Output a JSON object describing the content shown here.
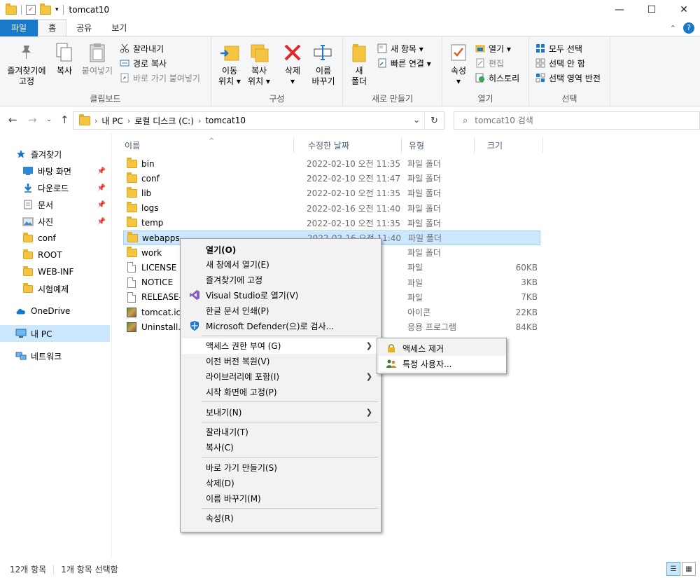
{
  "window": {
    "title": "tomcat10",
    "controls": {
      "minimize": "—",
      "maximize": "☐",
      "close": "✕"
    }
  },
  "ribbon_tabs": [
    {
      "label": "파일",
      "style": "file"
    },
    {
      "label": "홈",
      "style": "active"
    },
    {
      "label": "공유",
      "style": "normal"
    },
    {
      "label": "보기",
      "style": "normal"
    }
  ],
  "ribbon": {
    "clipboard": {
      "group_label": "클립보드",
      "pin_label_1": "즐겨찾기에",
      "pin_label_2": "고정",
      "copy_label": "복사",
      "paste_label": "붙여넣기",
      "cut_label": "잘라내기",
      "copy_path_label": "경로 복사",
      "paste_shortcut_label": "바로 가기 붙여넣기"
    },
    "organize": {
      "group_label": "구성",
      "move_label_1": "이동",
      "move_label_2": "위치 ▾",
      "copyto_label_1": "복사",
      "copyto_label_2": "위치 ▾",
      "delete_label_1": "삭제",
      "delete_label_2": "▾",
      "rename_label_1": "이름",
      "rename_label_2": "바꾸기"
    },
    "new": {
      "group_label": "새로 만들기",
      "new_folder_label_1": "새",
      "new_folder_label_2": "폴더",
      "new_item_label": "새 항목 ▾",
      "easy_access_label": "빠른 연결 ▾"
    },
    "open": {
      "group_label": "열기",
      "properties_label_1": "속성",
      "properties_label_2": "▾",
      "open_label": "열기 ▾",
      "edit_label": "편집",
      "history_label": "히스토리"
    },
    "select": {
      "group_label": "선택",
      "select_all_label": "모두 선택",
      "select_none_label": "선택 안 함",
      "invert_label": "선택 영역 반전"
    }
  },
  "address": {
    "breadcrumbs": [
      "내 PC",
      "로컬 디스크 (C:)",
      "tomcat10"
    ],
    "search_placeholder": "tomcat10 검색"
  },
  "navpane": {
    "items": [
      {
        "label": "즐겨찾기",
        "icon": "star-icon",
        "pinned": false
      },
      {
        "label": "바탕 화면",
        "icon": "desktop-icon",
        "pinned": true
      },
      {
        "label": "다운로드",
        "icon": "download-icon",
        "pinned": true
      },
      {
        "label": "문서",
        "icon": "document-icon",
        "pinned": true
      },
      {
        "label": "사진",
        "icon": "pictures-icon",
        "pinned": true
      },
      {
        "label": "conf",
        "icon": "folder-icon",
        "pinned": false
      },
      {
        "label": "ROOT",
        "icon": "folder-icon",
        "pinned": false
      },
      {
        "label": "WEB-INF",
        "icon": "folder-icon",
        "pinned": false
      },
      {
        "label": "시험예제",
        "icon": "folder-icon",
        "pinned": false
      },
      {
        "label": "OneDrive",
        "icon": "cloud-icon",
        "pinned": false
      },
      {
        "label": "내 PC",
        "icon": "computer-icon",
        "pinned": false
      },
      {
        "label": "네트워크",
        "icon": "network-icon",
        "pinned": false
      }
    ],
    "pin_glyph": "📌"
  },
  "filelist": {
    "columns": [
      "이름",
      "수정한 날짜",
      "유형",
      "크기"
    ],
    "rows": [
      {
        "name": "bin",
        "date": "2022-02-10 오전 11:35",
        "type": "파일 폴더",
        "size": "",
        "icon": "folder"
      },
      {
        "name": "conf",
        "date": "2022-02-10 오전 11:47",
        "type": "파일 폴더",
        "size": "",
        "icon": "folder"
      },
      {
        "name": "lib",
        "date": "2022-02-10 오전 11:35",
        "type": "파일 폴더",
        "size": "",
        "icon": "folder"
      },
      {
        "name": "logs",
        "date": "2022-02-16 오전 11:40",
        "type": "파일 폴더",
        "size": "",
        "icon": "folder"
      },
      {
        "name": "temp",
        "date": "2022-02-10 오전 11:35",
        "type": "파일 폴더",
        "size": "",
        "icon": "folder"
      },
      {
        "name": "webapps",
        "date": "2022-02-16 오전 11:40",
        "type": "파일 폴더",
        "size": "",
        "icon": "folder"
      },
      {
        "name": "work",
        "date": "11:47",
        "type": "파일 폴더",
        "size": "",
        "icon": "folder"
      },
      {
        "name": "LICENSE",
        "date": "0:19",
        "type": "파일",
        "size": "60KB",
        "icon": "file"
      },
      {
        "name": "NOTICE",
        "date": "0:19",
        "type": "파일",
        "size": "3KB",
        "icon": "file"
      },
      {
        "name": "RELEASE-N",
        "date": "0:19",
        "type": "파일",
        "size": "7KB",
        "icon": "file"
      },
      {
        "name": "tomcat.ico",
        "date": "0:19",
        "type": "아이콘",
        "size": "22KB",
        "icon": "image"
      },
      {
        "name": "Uninstall.ex",
        "date": "0:22",
        "type": "응용 프로그램",
        "size": "84KB",
        "icon": "image"
      }
    ],
    "selected_index": 5
  },
  "context_menu": {
    "items": [
      {
        "label": "열기(O)",
        "bold": true
      },
      {
        "label": "새 창에서 열기(E)"
      },
      {
        "label": "즐겨찾기에 고정"
      },
      {
        "label": "Visual Studio로 열기(V)",
        "icon": "visual-studio-icon"
      },
      {
        "label": "한글 문서 인쇄(P)"
      },
      {
        "label": "Microsoft Defender(으)로 검사...",
        "icon": "defender-icon"
      },
      {
        "sep": true
      },
      {
        "label": "액세스 권한 부여 (G)",
        "submenu": true,
        "hot": true
      },
      {
        "label": "이전 버전 복원(V)"
      },
      {
        "label": "라이브러리에 포함(I)",
        "submenu": true
      },
      {
        "label": "시작 화면에 고정(P)"
      },
      {
        "sep": true
      },
      {
        "label": "보내기(N)",
        "submenu": true
      },
      {
        "sep": true
      },
      {
        "label": "잘라내기(T)"
      },
      {
        "label": "복사(C)"
      },
      {
        "sep": true
      },
      {
        "label": "바로 가기 만들기(S)"
      },
      {
        "label": "삭제(D)"
      },
      {
        "label": "이름 바꾸기(M)"
      },
      {
        "sep": true
      },
      {
        "label": "속성(R)"
      }
    ],
    "submenu": [
      {
        "label": "액세스 제거",
        "icon": "lock-icon"
      },
      {
        "label": "특정 사용자...",
        "icon": "users-icon",
        "hot": true
      }
    ]
  },
  "status": {
    "item_count": "12개 항목",
    "selected_count": "1개 항목 선택함"
  },
  "colors": {
    "accent": "#1979ca",
    "selection": "#cce8ff",
    "folder": "#f5c542"
  }
}
